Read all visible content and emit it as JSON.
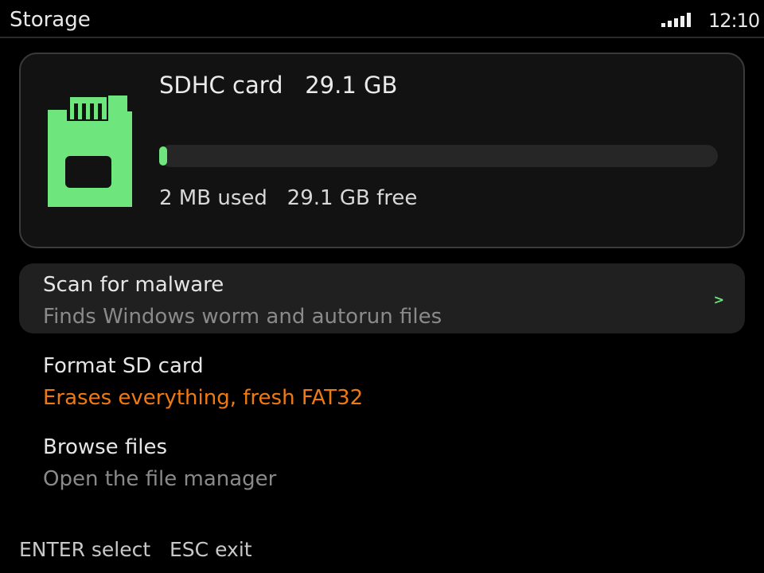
{
  "status": {
    "title": "Storage",
    "clock": "12:10",
    "signal_icon": "signal-bars-icon"
  },
  "card": {
    "icon": "sd-card-icon",
    "name": "SDHC card",
    "capacity": "29.1 GB",
    "used": "2 MB used",
    "free": "29.1 GB free",
    "used_fraction": 0.0001
  },
  "menu": {
    "items": [
      {
        "label": "Scan for malware",
        "desc": "Finds Windows worm and autorun files",
        "selected": true
      },
      {
        "label": "Format SD card",
        "desc": "Erases everything, fresh FAT32",
        "warning": true
      },
      {
        "label": "Browse files",
        "desc": "Open the file manager"
      }
    ]
  },
  "footer": {
    "enter": "ENTER select",
    "esc": "ESC exit"
  },
  "colors": {
    "accent": "#6ee67d",
    "warning": "#ef7a12",
    "background": "#000000"
  }
}
